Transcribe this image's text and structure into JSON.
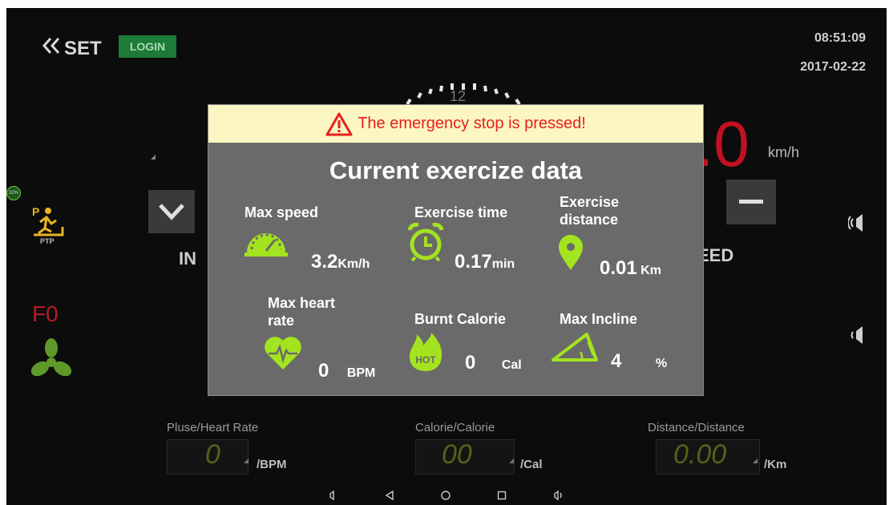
{
  "header": {
    "back_label": "SET",
    "login_label": "LOGIN",
    "time": "08:51:09",
    "date": "2017-02-22"
  },
  "dashboard": {
    "dial_number": "12",
    "speed_value": ".0",
    "speed_unit": "km/h",
    "incline_label": "IN",
    "speed_label": "EED",
    "battery": "32%",
    "program_label": "PTP",
    "fan_label": "F0"
  },
  "metrics": [
    {
      "label": "Pluse/Heart Rate",
      "value": "0",
      "unit": "/BPM"
    },
    {
      "label": "Calorie/Calorie",
      "value": "00",
      "unit": "/Cal"
    },
    {
      "label": "Distance/Distance",
      "value": "0.00",
      "unit": "/Km"
    }
  ],
  "modal": {
    "alert": "The emergency stop is pressed!",
    "title": "Current exercize data",
    "stats": {
      "max_speed": {
        "label": "Max speed",
        "value": "3.2",
        "unit": "Km/h",
        "icon": "speedometer-icon"
      },
      "exercise_time": {
        "label": "Exercise time",
        "value": "0.17",
        "unit": "min",
        "icon": "alarm-clock-icon"
      },
      "distance": {
        "label_line1": "Exercise",
        "label_line2": "distance",
        "value": "0.01",
        "unit": "Km",
        "icon": "location-pin-icon"
      },
      "heart_rate": {
        "label_line1": "Max heart",
        "label_line2": "rate",
        "value": "0",
        "unit": "BPM",
        "icon": "heart-icon"
      },
      "calorie": {
        "label": "Burnt Calorie",
        "value": "0",
        "unit": "Cal",
        "icon": "fire-icon",
        "icon_text": "HOT"
      },
      "incline": {
        "label": "Max Incline",
        "value": "4",
        "unit": "%",
        "icon": "incline-icon"
      }
    }
  },
  "colors": {
    "accent_green": "#a4e31f",
    "speed_red": "#c0121f",
    "alert_red": "#e8201f",
    "alert_bg": "#fbf6c2"
  }
}
